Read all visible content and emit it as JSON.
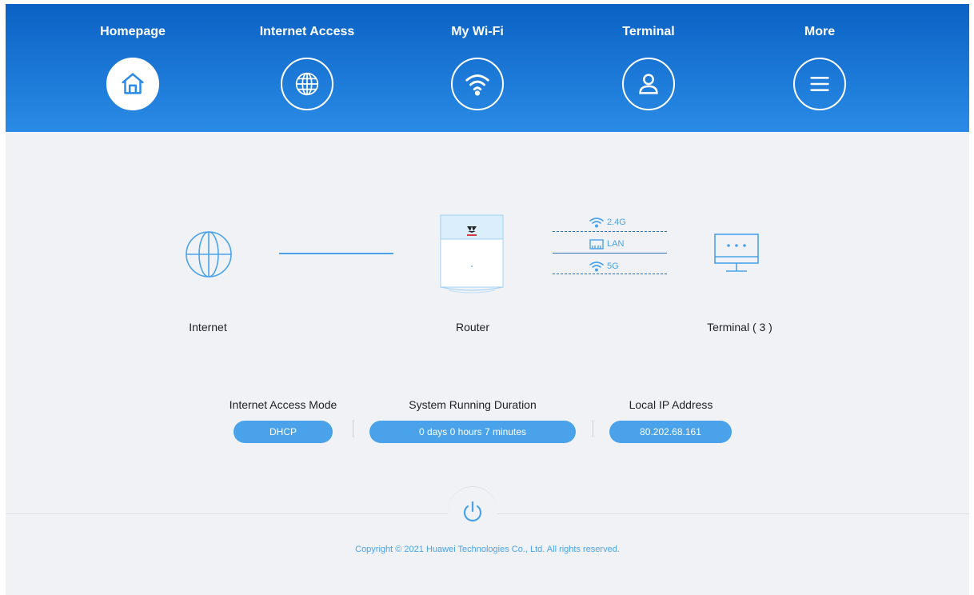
{
  "nav": {
    "items": [
      {
        "label": "Homepage",
        "icon": "home-icon",
        "active": true
      },
      {
        "label": "Internet Access",
        "icon": "globe-icon",
        "active": false
      },
      {
        "label": "My Wi-Fi",
        "icon": "wifi-icon",
        "active": false
      },
      {
        "label": "Terminal",
        "icon": "user-icon",
        "active": false
      },
      {
        "label": "More",
        "icon": "menu-icon",
        "active": false
      }
    ]
  },
  "topology": {
    "internet_label": "Internet",
    "router_label": "Router",
    "terminal_label": "Terminal ( 3 )",
    "connections": {
      "band_24": "2.4G",
      "lan": "LAN",
      "band_5": "5G"
    }
  },
  "info": {
    "access_mode": {
      "title": "Internet Access Mode",
      "value": "DHCP"
    },
    "uptime": {
      "title": "System Running Duration",
      "value": "0 days 0 hours 7 minutes"
    },
    "local_ip": {
      "title": "Local IP Address",
      "value": "80.202.68.161"
    }
  },
  "footer": {
    "copyright": "Copyright © 2021 Huawei Technologies Co., Ltd. All rights reserved."
  },
  "colors": {
    "header_top": "#0b62c4",
    "header_bottom": "#2a8be6",
    "accent": "#4aa3ea",
    "background": "#f1f2f6"
  }
}
